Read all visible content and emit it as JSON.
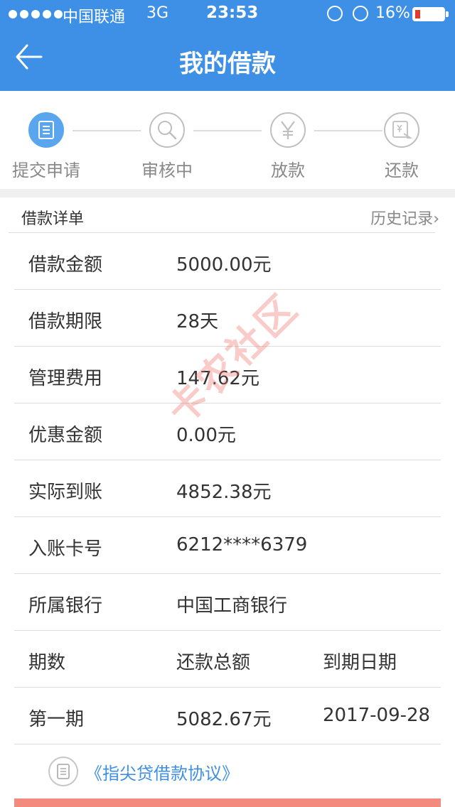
{
  "status_bar": {
    "carrier": "中国联通",
    "network": "3G",
    "time": "23:53",
    "battery_percent": "16%",
    "battery_level": 0.16
  },
  "nav": {
    "title": "我的借款"
  },
  "steps": [
    {
      "label": "提交申请",
      "icon": "document-icon",
      "active": true
    },
    {
      "label": "审核中",
      "icon": "search-icon",
      "active": false
    },
    {
      "label": "放款",
      "icon": "yen-icon",
      "active": false
    },
    {
      "label": "还款",
      "icon": "receipt-icon",
      "active": false
    }
  ],
  "detail": {
    "title": "借款详单",
    "history_link": "历史记录"
  },
  "rows": [
    {
      "key": "借款金额",
      "value": "5000.00元"
    },
    {
      "key": "借款期限",
      "value": "28天"
    },
    {
      "key": "管理费用",
      "value": "147.62元"
    },
    {
      "key": "优惠金额",
      "value": "0.00元"
    },
    {
      "key": "实际到账",
      "value": "4852.38元"
    },
    {
      "key": "入账卡号",
      "value": "6212****6379"
    },
    {
      "key": "所属银行",
      "value": "中国工商银行"
    }
  ],
  "schedule": {
    "headers": [
      "期数",
      "还款总额",
      "到期日期"
    ],
    "rows": [
      [
        "第一期",
        "5082.67元",
        "2017-09-28"
      ]
    ]
  },
  "agreement": {
    "text": "《指尖贷借款协议》"
  },
  "watermark": "卡农社区",
  "colors": {
    "primary": "#3e8fe6",
    "active_step": "#5aa6ee",
    "bottom_button": "#f28a7d",
    "battery_low": "#e23a2e"
  }
}
